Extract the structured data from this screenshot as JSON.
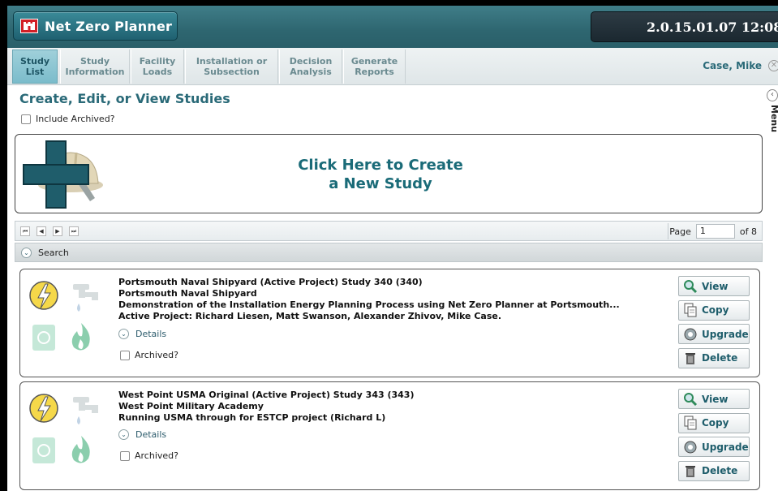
{
  "header": {
    "app_title": "Net Zero Planner",
    "version_time": "2.0.15.01.07 12:08"
  },
  "nav": {
    "tabs": [
      {
        "label": "Study List",
        "active": true
      },
      {
        "label": "Study Information",
        "active": false
      },
      {
        "label": "Facility Loads",
        "active": false
      },
      {
        "label": "Installation or Subsection",
        "active": false
      },
      {
        "label": "Decision Analysis",
        "active": false
      },
      {
        "label": "Generate Reports",
        "active": false
      }
    ],
    "user": "Case, Mike"
  },
  "side_menu": {
    "label": "Menu"
  },
  "main": {
    "title": "Create, Edit, or View Studies",
    "include_archived_label": "Include Archived?",
    "create_line1": "Click Here to Create",
    "create_line2": "a New Study"
  },
  "pager": {
    "page_label": "Page",
    "page_value": "1",
    "of_label": "of 8"
  },
  "search": {
    "label": "Search"
  },
  "studies": [
    {
      "title": "Portsmouth Naval Shipyard (Active Project) Study 340 (340)",
      "installation": "Portsmouth Naval Shipyard",
      "description": "Demonstration of the Installation Energy Planning Process using Net Zero Planner at Portsmouth...",
      "team": "Active Project: Richard Liesen, Matt Swanson, Alexander Zhivov, Mike Case.",
      "details_label": "Details",
      "archived_label": "Archived?"
    },
    {
      "title": "West Point USMA Original (Active Project) Study 343 (343)",
      "installation": "West Point Military Academy",
      "description": "Running USMA through for ESTCP project (Richard L)",
      "details_label": "Details",
      "archived_label": "Archived?"
    }
  ],
  "actions": {
    "view": "View",
    "copy": "Copy",
    "upgrade": "Upgrade",
    "delete": "Delete"
  },
  "colors": {
    "accent": "#2a6a78",
    "header": "#2e6670",
    "active_tab": "#7bbccb",
    "create_text": "#1a6b78"
  },
  "icons": [
    "electricity-icon",
    "water-faucet-icon",
    "recycle-bin-icon",
    "gas-flame-icon",
    "magnifier-icon",
    "copy-icon",
    "upgrade-icon",
    "trash-icon",
    "plus-icon",
    "hardhat-icon"
  ]
}
